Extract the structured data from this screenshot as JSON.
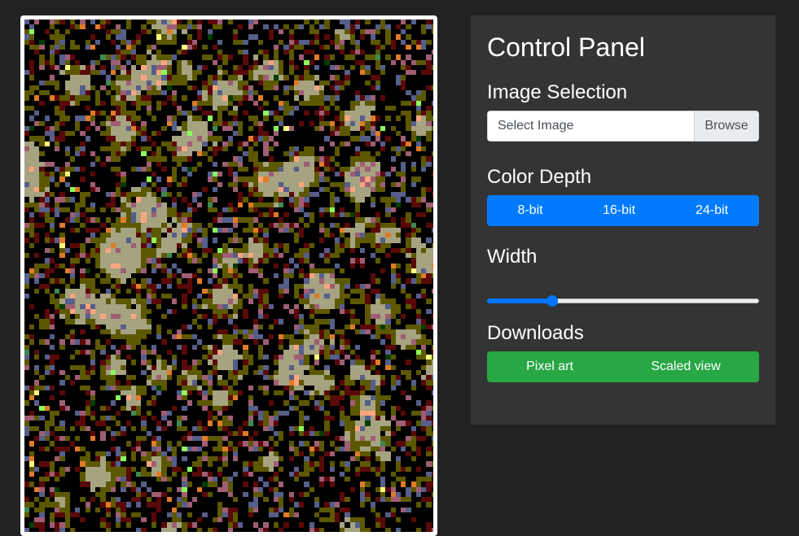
{
  "panel": {
    "title": "Control Panel",
    "image_selection": {
      "heading": "Image Selection",
      "placeholder": "Select Image",
      "browse_label": "Browse"
    },
    "color_depth": {
      "heading": "Color Depth",
      "options": [
        "8-bit",
        "16-bit",
        "24-bit"
      ]
    },
    "width": {
      "heading": "Width",
      "slider_fraction": 0.24
    },
    "downloads": {
      "heading": "Downloads",
      "pixel_art_label": "Pixel art",
      "scaled_view_label": "Scaled view"
    }
  },
  "colors": {
    "background": "#222222",
    "panel": "#343434",
    "primary": "#007bff",
    "success": "#28a745",
    "palette": [
      "#000000",
      "#a6a381",
      "#5c5800",
      "#5a0909",
      "#565e8a",
      "#9f5e74",
      "#ffa57e",
      "#e07b28",
      "#3c8a52",
      "#8cff5e",
      "#003d00",
      "#ffff80"
    ]
  }
}
